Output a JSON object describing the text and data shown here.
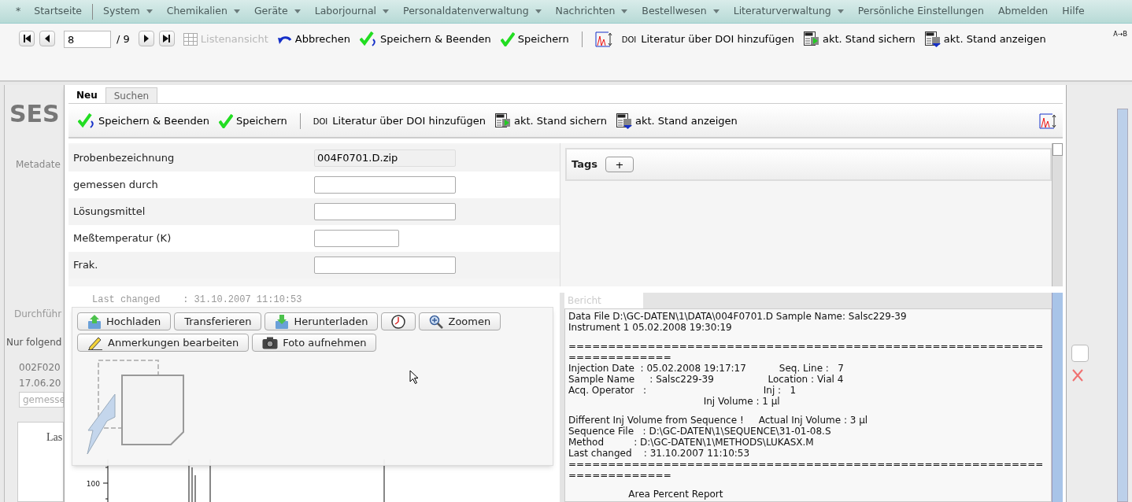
{
  "menu": [
    {
      "label": "*",
      "dropdown": false
    },
    {
      "label": "Startseite",
      "dropdown": false
    },
    {
      "label": "System",
      "dropdown": true
    },
    {
      "label": "Chemikalien",
      "dropdown": true
    },
    {
      "label": "Geräte",
      "dropdown": true
    },
    {
      "label": "Laborjournal",
      "dropdown": true
    },
    {
      "label": "Personaldatenverwaltung",
      "dropdown": true
    },
    {
      "label": "Nachrichten",
      "dropdown": true
    },
    {
      "label": "Bestellwesen",
      "dropdown": true
    },
    {
      "label": "Literaturverwaltung",
      "dropdown": true
    },
    {
      "label": "Persönliche Einstellungen",
      "dropdown": false
    },
    {
      "label": "Abmelden",
      "dropdown": false
    },
    {
      "label": "Hilfe",
      "dropdown": false
    }
  ],
  "pager": {
    "value": "8",
    "total": "/ 9"
  },
  "toolbar": [
    {
      "kind": "list-view",
      "label": "Listenansicht",
      "disabled": true
    },
    {
      "kind": "cancel",
      "label": "Abbrechen",
      "disabled": false
    },
    {
      "kind": "save-close",
      "label": "Speichern & Beenden",
      "disabled": false
    },
    {
      "kind": "save",
      "label": "Speichern",
      "disabled": false
    },
    {
      "kind": "separator"
    },
    {
      "kind": "chart"
    },
    {
      "kind": "doi",
      "prefix": "DOI",
      "label": "Literatur über DOI hinzufügen",
      "disabled": false
    },
    {
      "kind": "pdf-save",
      "label": "akt. Stand sichern",
      "disabled": false
    },
    {
      "kind": "pdf-show",
      "label": "akt. Stand anzeigen",
      "disabled": false
    }
  ],
  "toolbar_corner": "A→B",
  "background_page": {
    "title": "SES",
    "section": "Metadate",
    "tab": "Durchführ",
    "note": "Nur folgend",
    "entry_lines": [
      "002F020",
      "17.06.20"
    ],
    "field_placeholder": "gemesse",
    "chart_title": "Las"
  },
  "dialog": {
    "tabs": [
      {
        "label": "Neu",
        "selected": true
      },
      {
        "label": "Suchen",
        "selected": false
      }
    ],
    "toolbar": [
      {
        "kind": "save-close",
        "label": "Speichern & Beenden",
        "disabled": false
      },
      {
        "kind": "save",
        "label": "Speichern",
        "disabled": false
      },
      {
        "kind": "separator"
      },
      {
        "kind": "doi",
        "prefix": "DOI",
        "label": "Literatur über DOI hinzufügen",
        "disabled": false
      },
      {
        "kind": "pdf-save",
        "label": "akt. Stand sichern",
        "disabled": false
      },
      {
        "kind": "pdf-show",
        "label": "akt. Stand anzeigen",
        "disabled": false
      }
    ],
    "form": [
      {
        "label": "Probenbezeichnung",
        "value": "004F0701.D.zip",
        "readonly": true,
        "wide": true
      },
      {
        "label": "gemessen durch",
        "readonly": false,
        "wide": true
      },
      {
        "label": "Lösungsmittel",
        "readonly": false,
        "wide": true
      },
      {
        "label": "Meßtemperatur (K)",
        "readonly": false,
        "wide": false
      },
      {
        "label": "Frak.",
        "readonly": false,
        "wide": true
      }
    ],
    "tags": {
      "label": "Tags",
      "add_button": "+"
    },
    "faint_line": "Last changed    : 31.10.2007 11:10:53",
    "chart_tick": "100",
    "upload_panel": {
      "buttons": [
        {
          "kind": "upload",
          "label": "Hochladen"
        },
        {
          "kind": "text",
          "label": "Transferieren"
        },
        {
          "kind": "download",
          "label": "Herunterladen"
        },
        {
          "kind": "clock"
        },
        {
          "kind": "zoom",
          "label": "Zoomen"
        },
        {
          "kind": "annotate",
          "label": "Anmerkungen bearbeiten"
        },
        {
          "kind": "camera",
          "label": "Foto aufnehmen"
        }
      ]
    },
    "report": {
      "tab": "Bericht",
      "blocks": [
        [
          "Data File D:\\GC-DATEN\\1\\DATA\\004F0701.D Sample Name: Salsc229-39",
          "Instrument 1 05.02.2008 19:30:19"
        ],
        [
          "=========================================================================",
          "Injection Date  : 05.02.2008 19:17:17           Seq. Line :   7",
          "Sample Name     : Salsc229-39                  Location : Vial 4",
          "Acq. Operator   :                                       Inj :   1",
          "                                             Inj Volume : 1 µl"
        ],
        [
          "Different Inj Volume from Sequence !     Actual Inj Volume : 3 µl",
          "Sequence File   : D:\\GC-DATEN\\1\\SEQUENCE\\31-01-08.S",
          "Method          : D:\\GC-DATEN\\1\\METHODS\\LUKASX.M",
          "Last changed    : 31.10.2007 11:10:53",
          "========================================================================="
        ],
        [
          "                    Area Percent Report"
        ]
      ]
    }
  }
}
